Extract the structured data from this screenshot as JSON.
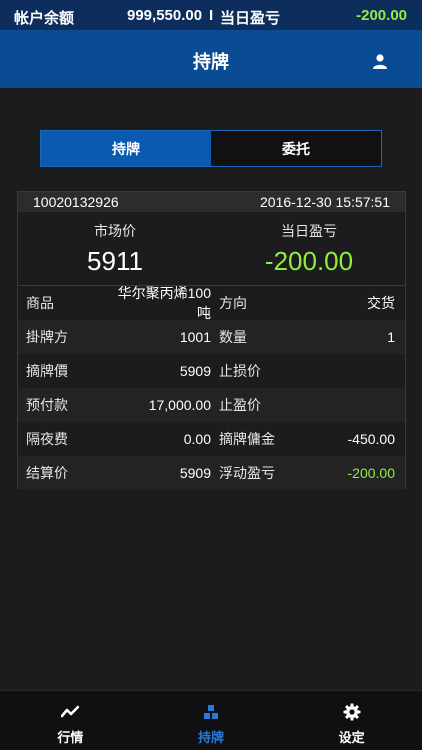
{
  "account": {
    "balance_label": "帐户余额",
    "balance": "999,550.00",
    "separator": "I",
    "pnl_label": "当日盈亏",
    "pnl": "-200.00"
  },
  "header": {
    "title": "持牌",
    "user_icon": "user-icon"
  },
  "tabs": [
    {
      "label": "持牌",
      "active": true
    },
    {
      "label": "委托",
      "active": false
    }
  ],
  "position": {
    "id": "10020132926",
    "datetime": "2016-12-30 15:57:51",
    "market_price_label": "市场价",
    "market_price": "5911",
    "day_pnl_label": "当日盈亏",
    "day_pnl": "-200.00",
    "rows": [
      {
        "k1": "商品",
        "v1": "华尔聚丙烯100吨",
        "k2": "方向",
        "v2": "交货"
      },
      {
        "k1": "掛牌方",
        "v1": "1001",
        "k2": "数量",
        "v2": "1"
      },
      {
        "k1": "摘牌價",
        "v1": "5909",
        "k2": "止损价",
        "v2": ""
      },
      {
        "k1": "预付款",
        "v1": "17,000.00",
        "k2": "止盈价",
        "v2": ""
      },
      {
        "k1": "隔夜费",
        "v1": "0.00",
        "k2": "摘牌傭金",
        "v2": "-450.00"
      },
      {
        "k1": "结算价",
        "v1": "5909",
        "k2": "浮动盈亏",
        "v2": "-200.00"
      }
    ]
  },
  "colors": {
    "positive_green": "#90ee3c",
    "brand_blue": "#0a4c94",
    "active_tab_blue": "#2a7ad8"
  },
  "nav": [
    {
      "label": "行情",
      "icon": "chart-line-icon",
      "active": false
    },
    {
      "label": "持牌",
      "icon": "position-blocks-icon",
      "active": true
    },
    {
      "label": "设定",
      "icon": "gear-icon",
      "active": false
    }
  ]
}
